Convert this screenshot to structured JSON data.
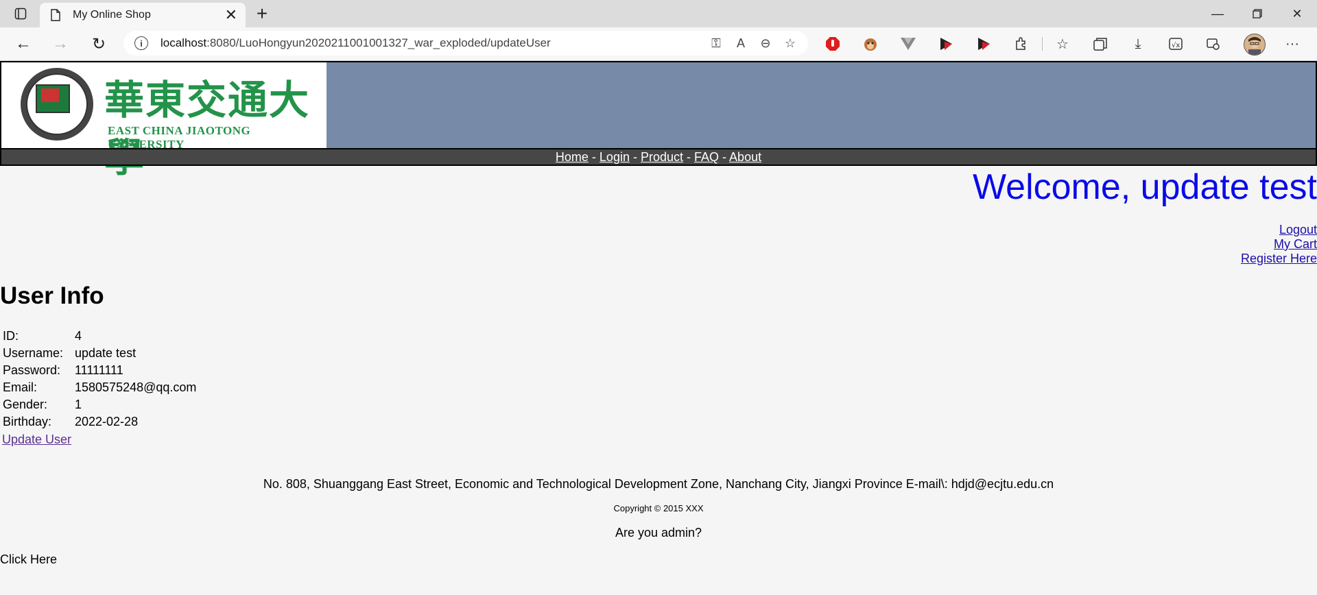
{
  "browser": {
    "tab_title": "My Online Shop",
    "url_host": "localhost",
    "url_rest": ":8080/LuoHongyun2020211001001327_war_exploded/updateUser"
  },
  "site": {
    "university_cn": "華東交通大學",
    "university_en": "EAST CHINA JIAOTONG UNIVERSITY",
    "banner_color": "#778ba9",
    "nav": [
      {
        "label": "Home"
      },
      {
        "label": "Login"
      },
      {
        "label": "Product"
      },
      {
        "label": "FAQ"
      },
      {
        "label": "About"
      }
    ],
    "nav_separator": " - "
  },
  "welcome": "Welcome, update test",
  "user_links": {
    "logout": "Logout",
    "cart": "My Cart",
    "register": "Register Here"
  },
  "user_info": {
    "title": "User Info",
    "rows": [
      {
        "key": "ID:",
        "value": "4"
      },
      {
        "key": "Username:",
        "value": "update test"
      },
      {
        "key": "Password:",
        "value": "11111111"
      },
      {
        "key": "Email:",
        "value": "1580575248@qq.com"
      },
      {
        "key": "Gender:",
        "value": "1"
      },
      {
        "key": "Birthday:",
        "value": "2022-02-28"
      }
    ],
    "update_link": "Update User"
  },
  "footer": {
    "address": "No. 808, Shuanggang East Street, Economic and Technological Development Zone, Nanchang City, Jiangxi Province E-mail\\: hdjd@ecjtu.edu.cn",
    "copyright": "Copyright © 2015 XXX",
    "admin_question": "Are you admin?",
    "click_here": "Click Here"
  }
}
